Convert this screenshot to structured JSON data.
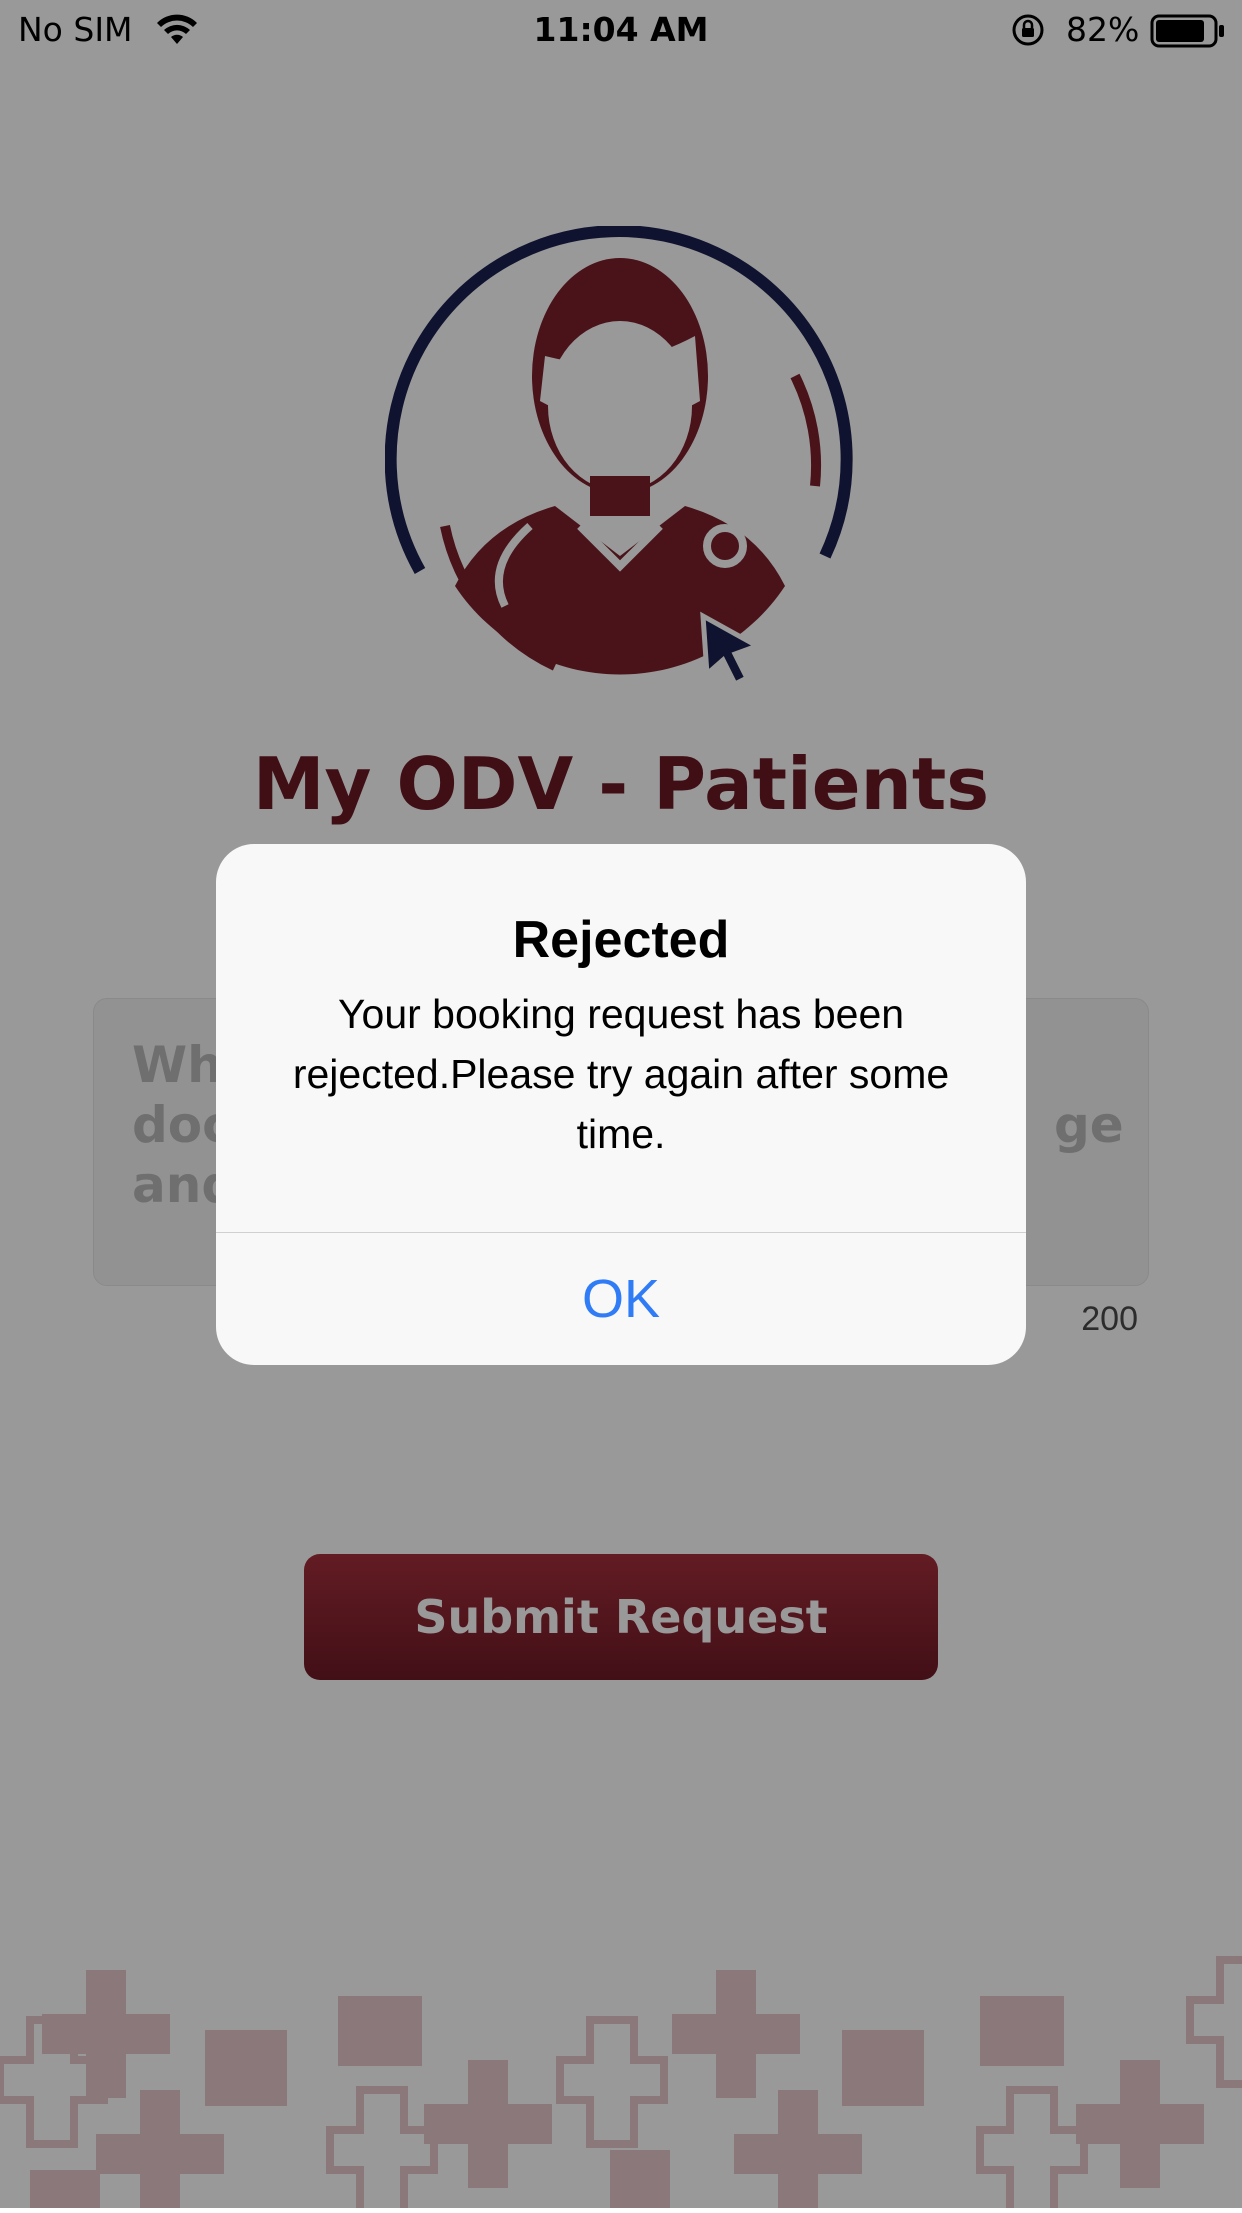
{
  "status_bar": {
    "carrier": "No SIM",
    "time": "11:04 AM",
    "battery_percent": "82%",
    "icons": [
      "wifi-icon",
      "orientation-lock-icon",
      "battery-icon"
    ]
  },
  "app": {
    "title": "My ODV - Patients",
    "logo_icon": "doctor-avatar-icon"
  },
  "form": {
    "reason_placeholder_lines": [
      "Wh",
      "doc",
      "and"
    ],
    "reason_placeholder_tail": "ge",
    "char_count": "200",
    "submit_label": "Submit Request"
  },
  "alert": {
    "title": "Rejected",
    "message": "Your booking request has been rejected.Please try again after some time.",
    "ok_label": "OK"
  },
  "colors": {
    "brand": "#6b1a24",
    "button_top": "#a52f3b",
    "button_bottom": "#6f1a27",
    "logo_ring": "#1b2150",
    "alert_action": "#2f7cf6",
    "pattern": "#e7c9cc"
  }
}
